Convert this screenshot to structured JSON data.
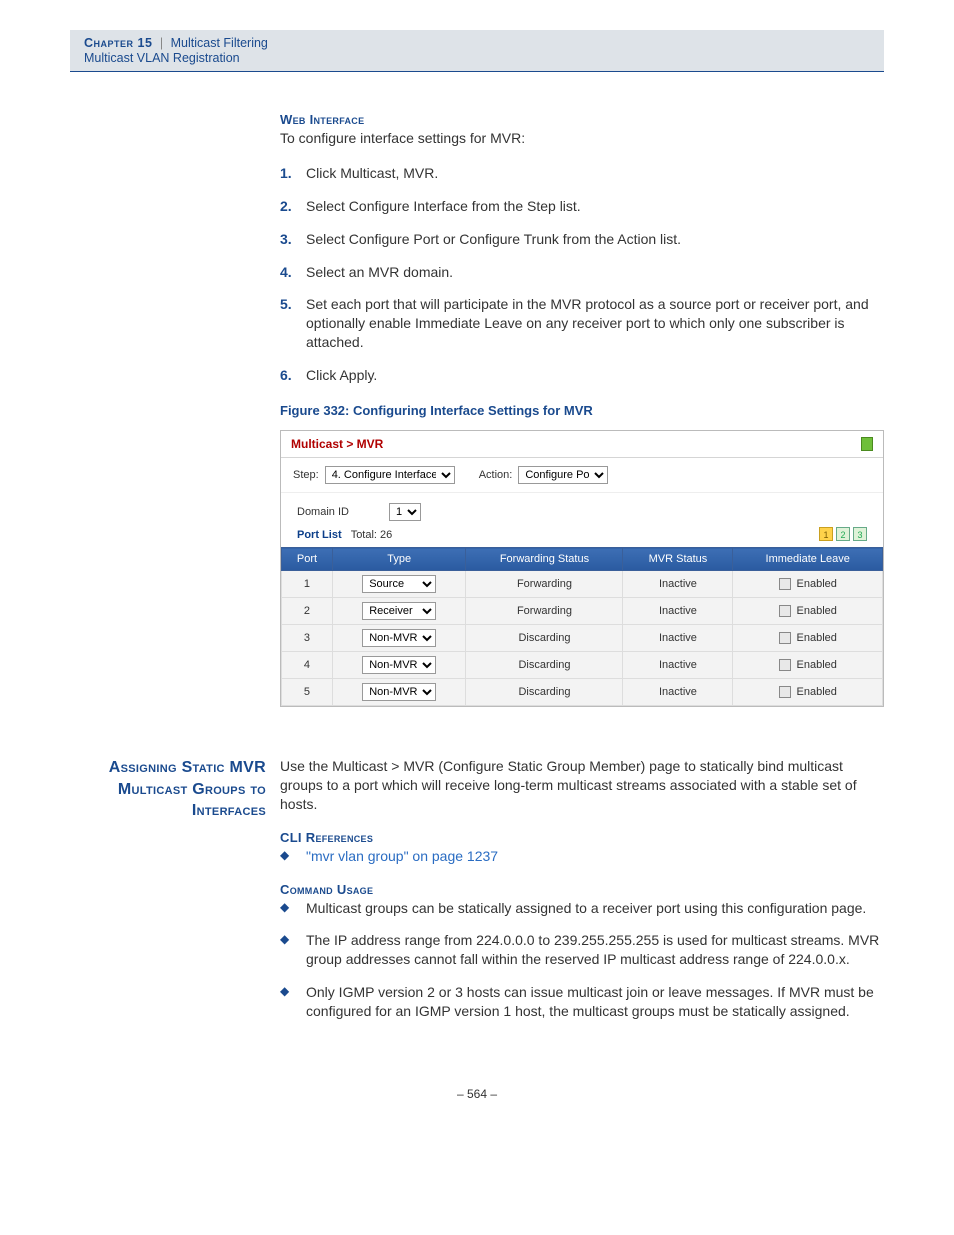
{
  "header": {
    "chapter": "Chapter 15",
    "section": "Multicast Filtering",
    "subsection": "Multicast VLAN Registration"
  },
  "block1": {
    "heading": "Web Interface",
    "intro": "To configure interface settings for MVR:",
    "steps": [
      "Click Multicast, MVR.",
      "Select Configure Interface from the Step list.",
      "Select Configure Port or Configure Trunk from the Action list.",
      "Select an MVR domain.",
      "Set each port that will participate in the MVR protocol as a source port or receiver port, and optionally enable Immediate Leave on any receiver port to which only one subscriber is attached.",
      "Click Apply."
    ],
    "figure_title": "Figure 332:  Configuring Interface Settings for MVR"
  },
  "app": {
    "breadcrumb": "Multicast > MVR",
    "step_label": "Step:",
    "step_value": "4. Configure Interface",
    "action_label": "Action:",
    "action_value": "Configure Port",
    "domain_label": "Domain ID",
    "domain_value": "1",
    "portlist_label": "Port List",
    "portlist_total_label": "Total:",
    "portlist_total": "26",
    "pages": [
      "1",
      "2",
      "3"
    ],
    "columns": [
      "Port",
      "Type",
      "Forwarding Status",
      "MVR Status",
      "Immediate Leave"
    ],
    "enabled_label": "Enabled",
    "rows": [
      {
        "port": "1",
        "type": "Source",
        "fwd": "Forwarding",
        "mvr": "Inactive"
      },
      {
        "port": "2",
        "type": "Receiver",
        "fwd": "Forwarding",
        "mvr": "Inactive"
      },
      {
        "port": "3",
        "type": "Non-MVR",
        "fwd": "Discarding",
        "mvr": "Inactive"
      },
      {
        "port": "4",
        "type": "Non-MVR",
        "fwd": "Discarding",
        "mvr": "Inactive"
      },
      {
        "port": "5",
        "type": "Non-MVR",
        "fwd": "Discarding",
        "mvr": "Inactive"
      }
    ]
  },
  "block2": {
    "side_heading": "Assigning Static MVR Multicast Groups to Interfaces",
    "intro": "Use the Multicast > MVR (Configure Static Group Member) page to statically bind multicast groups to a port which will receive long-term multicast streams associated with a stable set of hosts.",
    "cli_heading": "CLI References",
    "cli_link": "\"mvr vlan group\" on page 1237",
    "usage_heading": "Command Usage",
    "usage": [
      "Multicast groups can be statically assigned to a receiver port using this configuration page.",
      "The IP address range from 224.0.0.0 to 239.255.255.255 is used for multicast streams. MVR group addresses cannot fall within the reserved IP multicast address range of 224.0.0.x.",
      "Only IGMP version 2 or 3 hosts can issue multicast join or leave messages. If MVR must be configured for an IGMP version 1 host, the multicast groups must be statically assigned."
    ]
  },
  "page_number": "–  564  –"
}
